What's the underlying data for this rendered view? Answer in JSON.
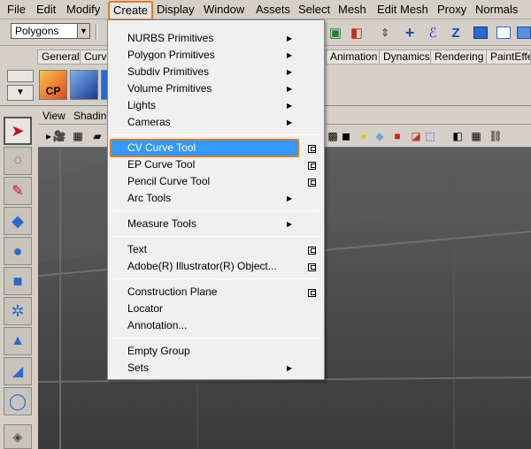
{
  "menubar": {
    "items": [
      "File",
      "Edit",
      "Modify",
      "Create",
      "Display",
      "Window",
      "Assets",
      "Select",
      "Mesh",
      "Edit Mesh",
      "Proxy",
      "Normals"
    ],
    "active": "Create"
  },
  "status_line": {
    "mode": "Polygons"
  },
  "shelf": {
    "tabs": [
      "General",
      "Curve",
      "Animation",
      "Dynamics",
      "Rendering",
      "PaintEffe"
    ],
    "cp_label": "CP"
  },
  "panel": {
    "menus": [
      "View",
      "Shadin"
    ]
  },
  "create_menu": {
    "items": [
      {
        "label": "NURBS Primitives",
        "submenu": true
      },
      {
        "label": "Polygon Primitives",
        "submenu": true
      },
      {
        "label": "Subdiv Primitives",
        "submenu": true
      },
      {
        "label": "Volume Primitives",
        "submenu": true
      },
      {
        "label": "Lights",
        "submenu": true
      },
      {
        "label": "Cameras",
        "submenu": true
      },
      {
        "label": "CV Curve Tool",
        "option_box": true,
        "highlighted": true
      },
      {
        "label": "EP Curve Tool",
        "option_box": true
      },
      {
        "label": "Pencil Curve Tool",
        "option_box": true
      },
      {
        "label": "Arc Tools",
        "submenu": true
      },
      {
        "label": "Measure Tools",
        "submenu": true
      },
      {
        "label": "Text",
        "option_box": true
      },
      {
        "label": "Adobe(R) Illustrator(R) Object...",
        "option_box": true
      },
      {
        "label": "Construction Plane",
        "option_box": true
      },
      {
        "label": "Locator"
      },
      {
        "label": "Annotation..."
      },
      {
        "label": "Empty Group"
      },
      {
        "label": "Sets",
        "submenu": true
      }
    ]
  },
  "colors": {
    "highlight": "#3399ff",
    "focus_outline": "#e07b28"
  },
  "icons": [
    "select-arrow-icon",
    "lasso-icon",
    "paint-select-icon",
    "move-icon",
    "rotate-icon",
    "scale-icon",
    "manipulator-icon",
    "soft-mod-icon",
    "sculpt-icon",
    "circle-icon",
    "layer-icon",
    "submenu-arrow-icon",
    "option-box-icon"
  ]
}
